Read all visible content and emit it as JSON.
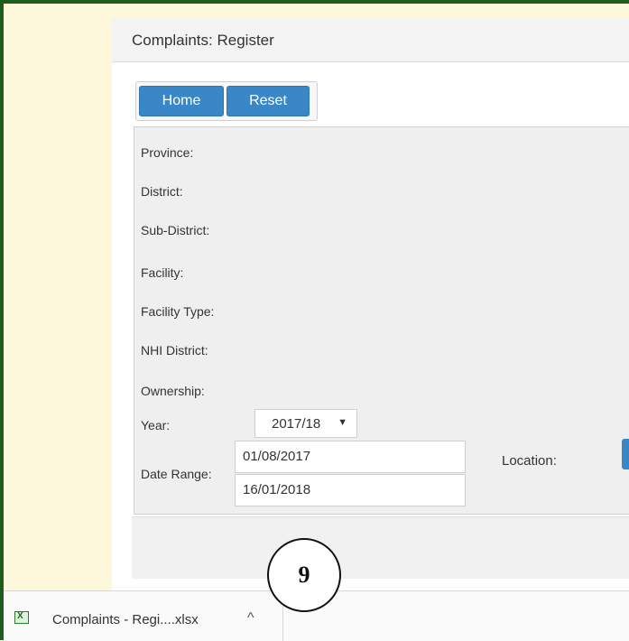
{
  "panel": {
    "title": "Complaints: Register"
  },
  "toolbar": {
    "home_label": "Home",
    "reset_label": "Reset"
  },
  "filters": {
    "province_label": "Province:",
    "district_label": "District:",
    "sub_district_label": "Sub-District:",
    "facility_label": "Facility:",
    "facility_type_label": "Facility Type:",
    "nhi_district_label": "NHI District:",
    "ownership_label": "Ownership:",
    "year_label": "Year:",
    "year_value": "2017/18",
    "date_range_label": "Date Range:",
    "date_from": "01/08/2017",
    "date_to": "16/01/2018",
    "location_label": "Location:"
  },
  "downloads": {
    "item_label": "Complaints - Regi....xlsx",
    "caret": "^"
  },
  "callout": {
    "number": "9"
  },
  "icons": {
    "dropdown": "▼"
  }
}
